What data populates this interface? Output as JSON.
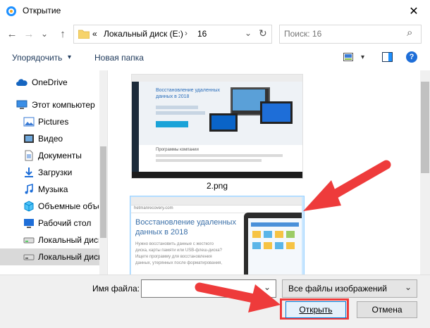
{
  "window": {
    "title": "Открытие",
    "close_glyph": "✕"
  },
  "nav": {
    "back_glyph": "←",
    "forward_glyph": "→",
    "recent_glyph": "⌄",
    "up_glyph": "↑",
    "breadcrumb": [
      "«",
      "Локальный диск (E:)",
      "›",
      "16"
    ],
    "dropdown_glyph": "⌄",
    "refresh_glyph": "↻",
    "search_placeholder": "Поиск: 16",
    "search_glyph": "⌕"
  },
  "toolbar": {
    "organize_label": "Упорядочить",
    "organize_caret": "▾",
    "new_folder_label": "Новая папка",
    "view_caret": "▾",
    "help_glyph": "?"
  },
  "sidebar": {
    "items": [
      {
        "label": "OneDrive",
        "icon": "cloud-icon"
      },
      {
        "label": "Этот компьютер",
        "icon": "computer-icon"
      },
      {
        "label": "Pictures",
        "icon": "pictures-icon"
      },
      {
        "label": "Видео",
        "icon": "video-icon"
      },
      {
        "label": "Документы",
        "icon": "documents-icon"
      },
      {
        "label": "Загрузки",
        "icon": "downloads-icon"
      },
      {
        "label": "Музыка",
        "icon": "music-icon"
      },
      {
        "label": "Объемные объекты",
        "icon": "3d-objects-icon"
      },
      {
        "label": "Рабочий стол",
        "icon": "desktop-icon"
      },
      {
        "label": "Локальный диск",
        "icon": "drive-icon"
      },
      {
        "label": "Локальный диск",
        "icon": "drive-icon"
      }
    ]
  },
  "files": [
    {
      "name": "2.png",
      "preview": {
        "heading": "Восстановление удаленных данных в 2018",
        "subheading": "Программы компании"
      }
    },
    {
      "name": "",
      "preview": {
        "url": "hetmanrecovery.com",
        "heading": "Восстановление удаленных данных в 2018",
        "body": "Нужно восстановить данные с жесткого диска, карты памяти или USB-флеш-диска? Ищете программу для восстановления данных, утерянных после форматирования,"
      }
    }
  ],
  "bottom": {
    "filename_label": "Имя файла:",
    "filename_value": "",
    "filename_caret": "⌄",
    "filter_value": "Все файлы изображений",
    "filter_caret": "⌄",
    "open_label": "Открыть",
    "cancel_label": "Отмена"
  },
  "colors": {
    "accent": "#0078d7",
    "arrow": "#ee3b3b",
    "selected": "#cce8ff"
  }
}
